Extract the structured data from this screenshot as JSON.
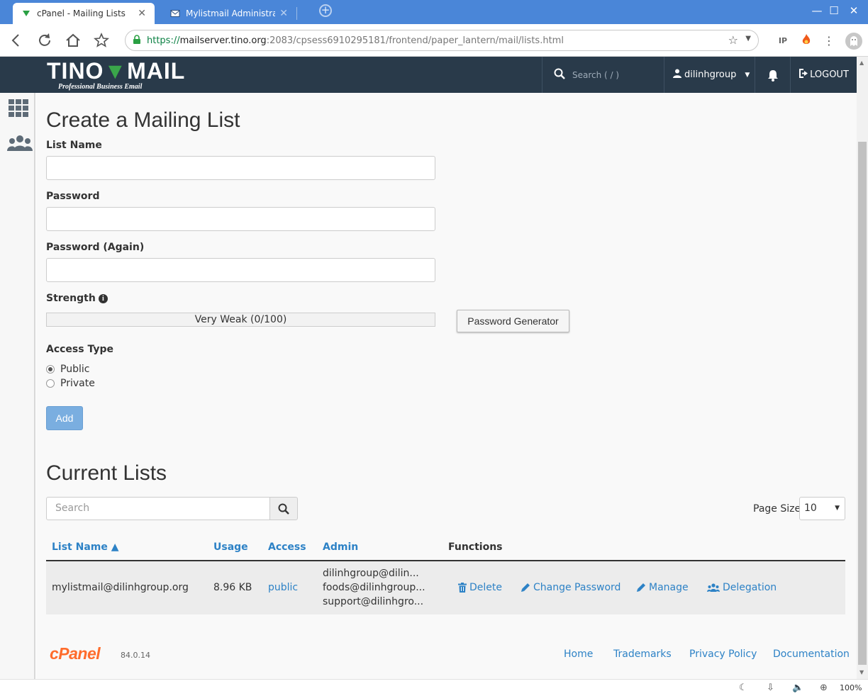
{
  "browser": {
    "tabs": [
      {
        "label": "cPanel - Mailing Lists",
        "active": true
      },
      {
        "label": "Mylistmail Administration",
        "active": false
      }
    ],
    "url": {
      "proto": "https://",
      "host": "mailserver.tino.org",
      "path": ":2083/cpsess6910295181/frontend/paper_lantern/mail/lists.html"
    },
    "window_controls": {
      "minimize": "—",
      "maximize": "☐",
      "close": "✕"
    },
    "zoom": "100%"
  },
  "header": {
    "brand": {
      "part1": "TINO",
      "part2": "MAIL"
    },
    "tagline": "Professional Business Email",
    "search_placeholder": "Search ( / )",
    "username": "dilinhgroup",
    "logout": "LOGOUT"
  },
  "form": {
    "title": "Create a Mailing List",
    "list_name_label": "List Name",
    "list_name_value": "",
    "password_label": "Password",
    "password_again_label": "Password (Again)",
    "strength_label": "Strength",
    "strength_value": "Very Weak (0/100)",
    "strength_score": 0,
    "password_generator": "Password Generator",
    "access_type_label": "Access Type",
    "access_options": [
      "Public",
      "Private"
    ],
    "access_selected": "Public",
    "add_button": "Add"
  },
  "current_lists": {
    "title": "Current Lists",
    "search_placeholder": "Search",
    "page_size_label": "Page Size",
    "page_size_value": "10",
    "columns": [
      "List Name ▲",
      "Usage",
      "Access",
      "Admin",
      "Functions"
    ],
    "rows": [
      {
        "list_name": "mylistmail@dilinhgroup.org",
        "usage": "8.96 KB",
        "access": "public",
        "admin": [
          "dilinhgroup@dilin...",
          "foods@dilinhgroup...",
          "support@dilinhgro..."
        ],
        "functions": [
          "Delete",
          "Change Password",
          "Manage",
          "Delegation"
        ]
      }
    ]
  },
  "footer": {
    "logo": "cPanel",
    "version": "84.0.14",
    "links": [
      "Home",
      "Trademarks",
      "Privacy Policy",
      "Documentation"
    ]
  },
  "colors": {
    "tab_bar": "#4a86d8",
    "header_bg": "#293a4a",
    "link": "#2d82c6",
    "add_button": "#7aaee0",
    "cpanel_orange": "#ff6c2c",
    "brand_green": "#3aa64a"
  }
}
